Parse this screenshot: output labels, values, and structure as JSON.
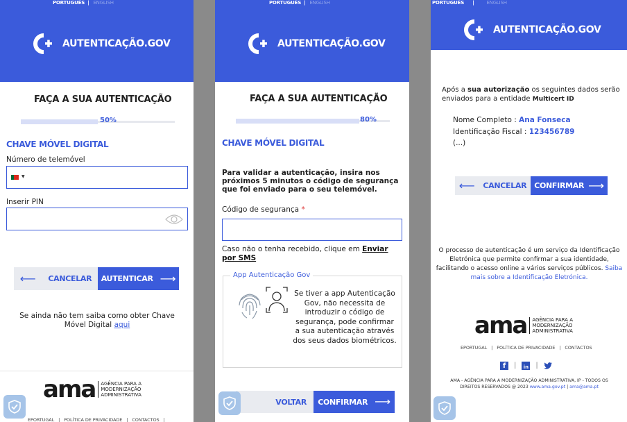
{
  "lang": {
    "pt": "PORTUGUÊS",
    "sep": "|",
    "en": "ENGLISH"
  },
  "brand": {
    "name": "AUTENTICAÇÃO.GOV"
  },
  "colors": {
    "primary": "#3b5bdb",
    "cancel_bg": "#e9ebf0"
  },
  "panel1": {
    "title": "FAÇA A SUA AUTENTICAÇÃO",
    "progress": {
      "percent": 50,
      "label": "50%"
    },
    "section": "CHAVE MÓVEL DIGITAL",
    "phone_label": "Número de telemóvel",
    "phone_value": "",
    "pin_label": "Inserir PIN",
    "pin_value": "",
    "cancel": "CANCELAR",
    "submit": "AUTENTICAR",
    "help_text": "Se ainda não tem saiba como obter Chave Móvel Digital",
    "help_link": "aqui"
  },
  "panel2": {
    "title": "FAÇA A SUA AUTENTICAÇÃO",
    "progress": {
      "percent": 80,
      "label": "80%"
    },
    "section": "CHAVE MÓVEL DIGITAL",
    "instructions": "Para validar a autenticação, insira nos próximos 5 minutos o código de segurança que foi enviado para o seu telemóvel.",
    "code_label": "Código de segurança",
    "code_required": "*",
    "code_value": "",
    "resend_text": "Caso não o tenha recebido, clique em",
    "resend_link": "Enviar por SMS",
    "app_legend": "App Autenticação Gov",
    "app_text": "Se tiver a app Autenticação Gov, não necessita de introduzir o código de segurança, pode confirmar a sua autenticação através dos seus dados biométricos.",
    "back": "VOLTAR",
    "confirm": "CONFIRMAR"
  },
  "panel3": {
    "intro_pre": "Após a",
    "intro_bold": "sua autorização",
    "intro_post": "os seguintes dados serão enviados para a entidade",
    "entity": "Multicert ID",
    "name_label": "Nome Completo :",
    "name_value": "Ana Fonseca",
    "nif_label": "Identificação Fiscal :",
    "nif_value": "123456789",
    "ellipsis": "(...)",
    "cancel": "CANCELAR",
    "confirm": "CONFIRMAR",
    "info_text": "O processo de autenticação é um serviço da Identificação Eletrónica que permite confirmar a sua identidade, facilitando o acesso online a vários serviços públicos.",
    "info_link": "Saiba mais sobre a Identificação Eletrónica.",
    "social": {
      "facebook": "f",
      "linkedin": "in",
      "twitter": "t"
    },
    "copy_line1": "AMA - AGÊNCIA PARA A MODERNIZAÇÃO ADMINISTRATIVA, IP - TODOS OS",
    "copy_line2": "DIREITOS RESERVADOS @ 2023",
    "copy_site": "www.ama.gov.pt",
    "copy_mail": "ama@ama.pt"
  },
  "footer": {
    "ama_word": "ama",
    "ama_line1": "AGÊNCIA PARA A",
    "ama_line2": "MODERNIZAÇÃO",
    "ama_line3": "ADMINISTRATIVA",
    "links": [
      "EPORTUGAL",
      "POLÍTICA DE PRIVACIDADE",
      "CONTACTOS"
    ]
  }
}
